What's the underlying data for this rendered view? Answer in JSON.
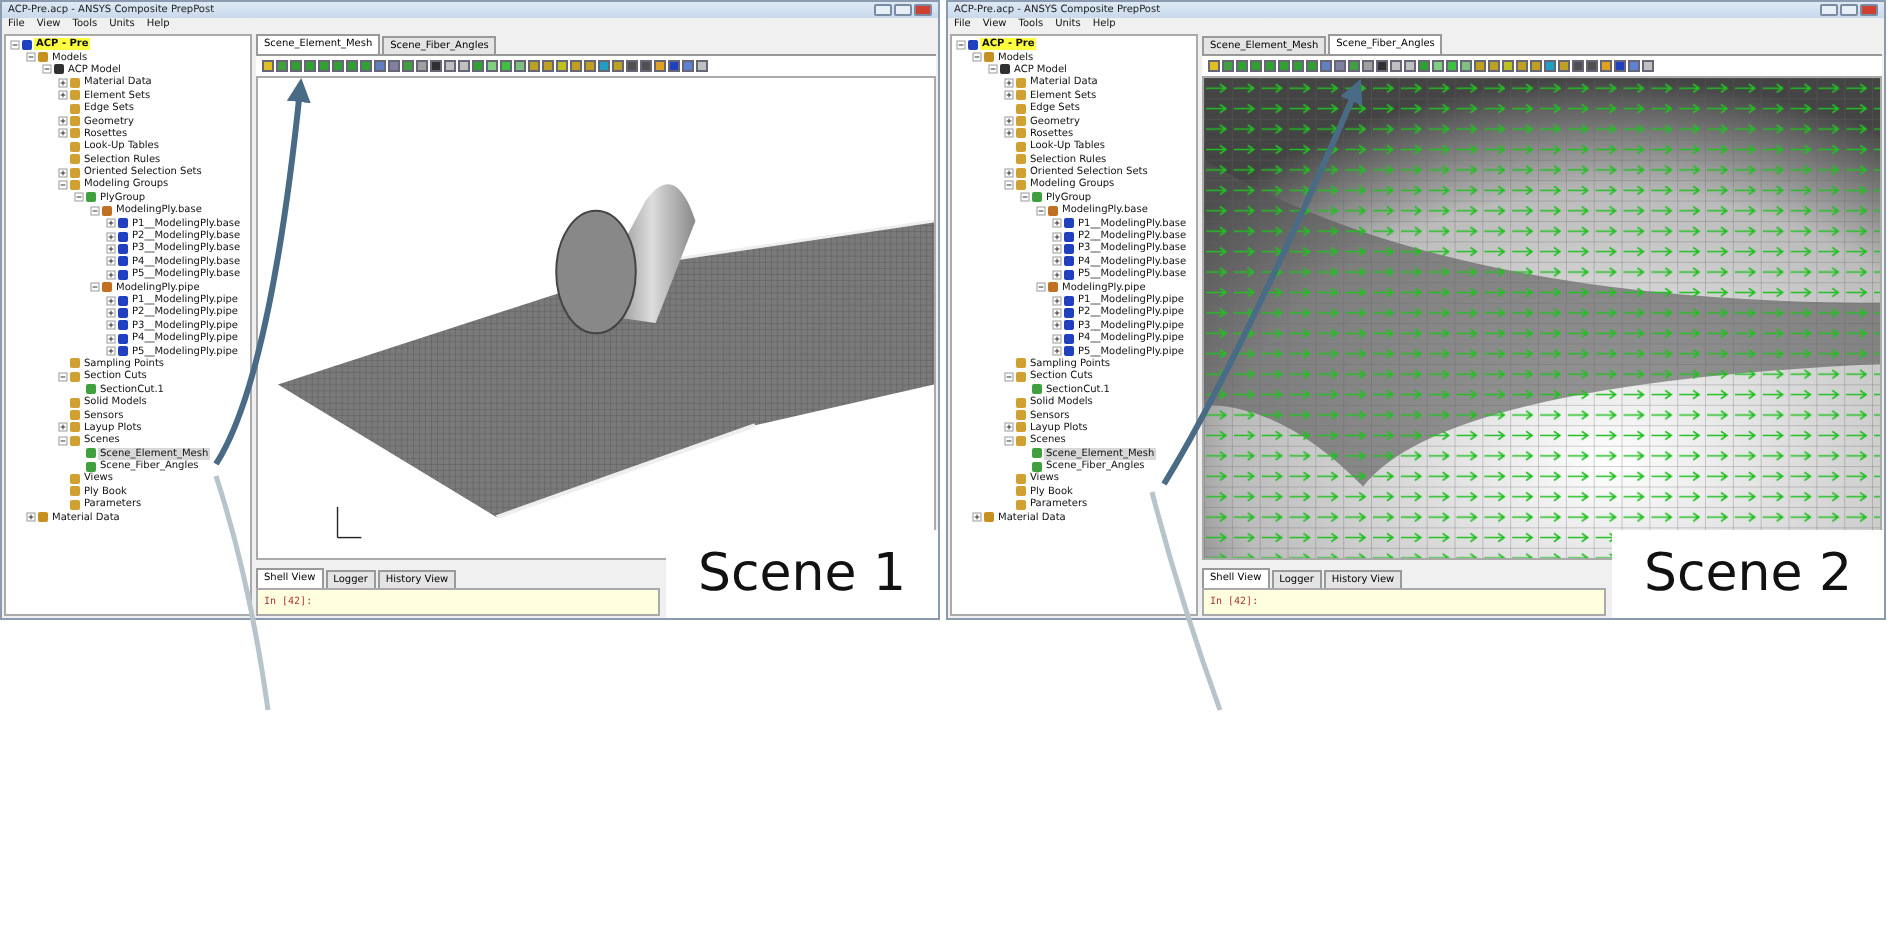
{
  "panels": [
    {
      "window": {
        "title": "ACP-Pre.acp - ANSYS Composite PrepPost"
      },
      "menu": [
        "File",
        "View",
        "Tools",
        "Units",
        "Help"
      ],
      "tree": [
        {
          "label": "ACP - Pre",
          "expanded": true,
          "children": [
            {
              "label": "Models",
              "expanded": true,
              "children": [
                {
                  "label": "ACP Model",
                  "expanded": true,
                  "children": [
                    {
                      "label": "Material Data",
                      "expanded": false
                    },
                    {
                      "label": "Element Sets",
                      "expanded": false
                    },
                    {
                      "label": "Edge Sets"
                    },
                    {
                      "label": "Geometry",
                      "expanded": false
                    },
                    {
                      "label": "Rosettes",
                      "expanded": false
                    },
                    {
                      "label": "Look-Up Tables"
                    },
                    {
                      "label": "Selection Rules"
                    },
                    {
                      "label": "Oriented Selection Sets",
                      "expanded": false
                    },
                    {
                      "label": "Modeling Groups",
                      "expanded": true,
                      "children": [
                        {
                          "label": "PlyGroup",
                          "expanded": true,
                          "children": [
                            {
                              "label": "ModelingPly.base",
                              "expanded": true,
                              "children": [
                                {
                                  "label": "P1__ModelingPly.base",
                                  "expanded": false
                                },
                                {
                                  "label": "P2__ModelingPly.base",
                                  "expanded": false
                                },
                                {
                                  "label": "P3__ModelingPly.base",
                                  "expanded": false
                                },
                                {
                                  "label": "P4__ModelingPly.base",
                                  "expanded": false
                                },
                                {
                                  "label": "P5__ModelingPly.base",
                                  "expanded": false
                                }
                              ]
                            },
                            {
                              "label": "ModelingPly.pipe",
                              "expanded": true,
                              "children": [
                                {
                                  "label": "P1__ModelingPly.pipe",
                                  "expanded": false
                                },
                                {
                                  "label": "P2__ModelingPly.pipe",
                                  "expanded": false
                                },
                                {
                                  "label": "P3__ModelingPly.pipe",
                                  "expanded": false
                                },
                                {
                                  "label": "P4__ModelingPly.pipe",
                                  "expanded": false
                                },
                                {
                                  "label": "P5__ModelingPly.pipe",
                                  "expanded": false
                                }
                              ]
                            }
                          ]
                        }
                      ]
                    },
                    {
                      "label": "Sampling Points"
                    },
                    {
                      "label": "Section Cuts",
                      "expanded": true,
                      "children": [
                        {
                          "label": "SectionCut.1"
                        }
                      ]
                    },
                    {
                      "label": "Solid Models"
                    },
                    {
                      "label": "Sensors"
                    },
                    {
                      "label": "Layup Plots",
                      "expanded": false
                    },
                    {
                      "label": "Scenes",
                      "expanded": true,
                      "children": [
                        {
                          "label": "Scene_Element_Mesh",
                          "selected": true
                        },
                        {
                          "label": "Scene_Fiber_Angles",
                          "selected": false
                        }
                      ]
                    },
                    {
                      "label": "Views"
                    },
                    {
                      "label": "Ply Book"
                    },
                    {
                      "label": "Parameters"
                    }
                  ]
                }
              ]
            },
            {
              "label": "Material Data",
              "expanded": false
            }
          ]
        }
      ],
      "tabs": [
        {
          "label": "Scene_Element_Mesh",
          "selected": true
        },
        {
          "label": "Scene_Fiber_Angles",
          "selected": false
        }
      ],
      "viewport": {
        "kind": "mesh"
      },
      "bottom_tabs": [
        {
          "label": "Shell View",
          "selected": true
        },
        {
          "label": "Logger",
          "selected": false
        },
        {
          "label": "History View",
          "selected": false
        }
      ],
      "shell_prompt": "In [42]:",
      "caption": "Scene 1"
    },
    {
      "window": {
        "title": "ACP-Pre.acp - ANSYS Composite PrepPost"
      },
      "menu": [
        "File",
        "View",
        "Tools",
        "Units",
        "Help"
      ],
      "tree": [
        {
          "label": "ACP - Pre",
          "expanded": true,
          "children": [
            {
              "label": "Models",
              "expanded": true,
              "children": [
                {
                  "label": "ACP Model",
                  "expanded": true,
                  "children": [
                    {
                      "label": "Material Data",
                      "expanded": false
                    },
                    {
                      "label": "Element Sets",
                      "expanded": false
                    },
                    {
                      "label": "Edge Sets"
                    },
                    {
                      "label": "Geometry",
                      "expanded": false
                    },
                    {
                      "label": "Rosettes",
                      "expanded": false
                    },
                    {
                      "label": "Look-Up Tables"
                    },
                    {
                      "label": "Selection Rules"
                    },
                    {
                      "label": "Oriented Selection Sets",
                      "expanded": false
                    },
                    {
                      "label": "Modeling Groups",
                      "expanded": true,
                      "children": [
                        {
                          "label": "PlyGroup",
                          "expanded": true,
                          "children": [
                            {
                              "label": "ModelingPly.base",
                              "expanded": true,
                              "children": [
                                {
                                  "label": "P1__ModelingPly.base",
                                  "expanded": false
                                },
                                {
                                  "label": "P2__ModelingPly.base",
                                  "expanded": false
                                },
                                {
                                  "label": "P3__ModelingPly.base",
                                  "expanded": false
                                },
                                {
                                  "label": "P4__ModelingPly.base",
                                  "expanded": false
                                },
                                {
                                  "label": "P5__ModelingPly.base",
                                  "expanded": false
                                }
                              ]
                            },
                            {
                              "label": "ModelingPly.pipe",
                              "expanded": true,
                              "children": [
                                {
                                  "label": "P1__ModelingPly.pipe",
                                  "expanded": false
                                },
                                {
                                  "label": "P2__ModelingPly.pipe",
                                  "expanded": false
                                },
                                {
                                  "label": "P3__ModelingPly.pipe",
                                  "expanded": false
                                },
                                {
                                  "label": "P4__ModelingPly.pipe",
                                  "expanded": false
                                },
                                {
                                  "label": "P5__ModelingPly.pipe",
                                  "expanded": false
                                }
                              ]
                            }
                          ]
                        }
                      ]
                    },
                    {
                      "label": "Sampling Points"
                    },
                    {
                      "label": "Section Cuts",
                      "expanded": true,
                      "children": [
                        {
                          "label": "SectionCut.1"
                        }
                      ]
                    },
                    {
                      "label": "Solid Models"
                    },
                    {
                      "label": "Sensors"
                    },
                    {
                      "label": "Layup Plots",
                      "expanded": false
                    },
                    {
                      "label": "Scenes",
                      "expanded": true,
                      "children": [
                        {
                          "label": "Scene_Element_Mesh",
                          "selected": true
                        },
                        {
                          "label": "Scene_Fiber_Angles",
                          "selected": false
                        }
                      ]
                    },
                    {
                      "label": "Views"
                    },
                    {
                      "label": "Ply Book"
                    },
                    {
                      "label": "Parameters"
                    }
                  ]
                }
              ]
            },
            {
              "label": "Material Data",
              "expanded": false
            }
          ]
        }
      ],
      "tabs": [
        {
          "label": "Scene_Element_Mesh",
          "selected": false
        },
        {
          "label": "Scene_Fiber_Angles",
          "selected": true
        }
      ],
      "viewport": {
        "kind": "fiber"
      },
      "bottom_tabs": [
        {
          "label": "Shell View",
          "selected": true
        },
        {
          "label": "Logger",
          "selected": false
        },
        {
          "label": "History View",
          "selected": false
        }
      ],
      "shell_prompt": "In [42]:",
      "caption": "Scene 2"
    }
  ]
}
